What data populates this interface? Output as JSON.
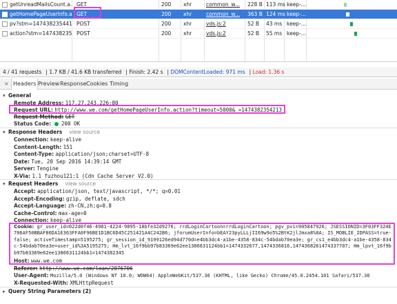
{
  "network": {
    "rows": [
      {
        "name": "getUnreadMailsCount.a...",
        "method": "GET",
        "status": "200",
        "type": "xhr",
        "initiator": "common_w...",
        "size": "228 B",
        "time": "113 ms",
        "conn": "keep-...",
        "selected": false
      },
      {
        "name": "getHomePageUserInfo.a...",
        "method": "GET",
        "status": "200",
        "type": "xhr",
        "initiator": "common_w...",
        "size": "363 B",
        "time": "124 ms",
        "conn": "keep-...",
        "selected": true
      },
      {
        "name": "pv?stm=1474382354412",
        "method": "POST",
        "status": "200",
        "type": "xhr",
        "initiator": "vds.js:2",
        "size": "52 B",
        "time": "43 ms",
        "conn": "keep-...",
        "selected": false
      },
      {
        "name": "action?stm=1474382355...",
        "method": "POST",
        "status": "200",
        "type": "xhr",
        "initiator": "vds.js:2",
        "size": "52 B",
        "time": "55 ms",
        "conn": "keep-...",
        "selected": false
      }
    ]
  },
  "status_bar": {
    "requests": "4 / 41 requests",
    "transferred": "1.7 KB / 41.6 KB transferred",
    "finish": "Finish: 2.42 s",
    "dcl": "DOMContentLoaded: 971 ms",
    "load": "Load: 1.36 s",
    "dcl_color": "#1a4fc7",
    "load_color": "#dd2222"
  },
  "tabs": {
    "close": "×",
    "items": [
      "Headers",
      "Preview",
      "Response",
      "Cookies",
      "Timing"
    ],
    "active": "Headers"
  },
  "general": {
    "title": "General",
    "remote_address_key": "Remote Address:",
    "remote_address": "117.27.243.226:80",
    "request_url_key": "Request URL:",
    "request_url": "http://www.we.com/getHomePageUserInfo.action?timeout=5000&_=1474382354213",
    "request_method_key": "Request Method:",
    "request_method": "GET",
    "status_code_key": "Status Code:",
    "status_code": "200 OK"
  },
  "response_headers": {
    "title": "Response Headers",
    "view_source": "view source",
    "items": [
      {
        "k": "Connection:",
        "v": "keep-alive"
      },
      {
        "k": "Content-Length:",
        "v": "151"
      },
      {
        "k": "Content-Type:",
        "v": "application/json;charset=UTF-8"
      },
      {
        "k": "Date:",
        "v": "Tue, 20 Sep 2016 14:39:14 GMT"
      },
      {
        "k": "Server:",
        "v": "Tengine"
      },
      {
        "k": "X-Via:",
        "v": "1.1 fuzhou121:1 (Cdn Cache Server V2.0)"
      }
    ]
  },
  "request_headers": {
    "title": "Request Headers",
    "view_source": "view source",
    "items": [
      {
        "k": "Accept:",
        "v": "application/json, text/javascript, */*; q=0.01"
      },
      {
        "k": "Accept-Encoding:",
        "v": "gzip, deflate, sdch"
      },
      {
        "k": "Accept-Language:",
        "v": "zh-CN,zh;q=0.8"
      },
      {
        "k": "Cache-Control:",
        "v": "max-age=0"
      },
      {
        "k": "Connection:",
        "v": "keep-alive"
      }
    ],
    "cookie_key": "Cookie:",
    "cookie": "gr_user_id=022d0f46-4981-4224-9895-18bfe32d9276; rrdLoginCartoon=rrdLoginCartoon; pgv_pvi=905847926; JSESSIONID=3F03FF324E706AF50BBAF86DA1E363FFA0F96BE1D1BC6D45C251421A4C242B6; jforumUserInfo=bEAY23pyLLLjII69w9o5%2BtK2jlJmxa8%0A; IS_MOBLIE_IDPASS=true-false; activeTimestamp=5195275; gr_session_id_9199126ed94d770d=e4bb3dc4-a1be-4358-834c-54bdab70ea3e; gr_cs1_e4bb3dc4-a1be-4358-834c-54bdab70ea3e=user_id%3A5195275; Hm_lvt_16f9bb97b83369e62ee1386631124bb1=1474332677,1474336816,1474368261474337707; Hm_lpvt_16f9bb97b83369e62ee1386631124bb1=1474382345",
    "host_key": "Host:",
    "host": "www.we.com",
    "referer_key": "Referer:",
    "referer": "http://www.we.com/loan/2076706",
    "user_agent_key": "User-Agent:",
    "user_agent": "Mozilla/5.0 (Windows NT 10.0; WOW64) AppleWebKit/537.36 (KHTML, like Gecko) Chrome/45.0.2454.101 Safari/537.36",
    "xrw_key": "X-Requested-With:",
    "xrw": "XMLHttpRequest"
  },
  "query": {
    "title": "Query String Parameters (2)"
  },
  "highlight_color": "#e43fd6"
}
